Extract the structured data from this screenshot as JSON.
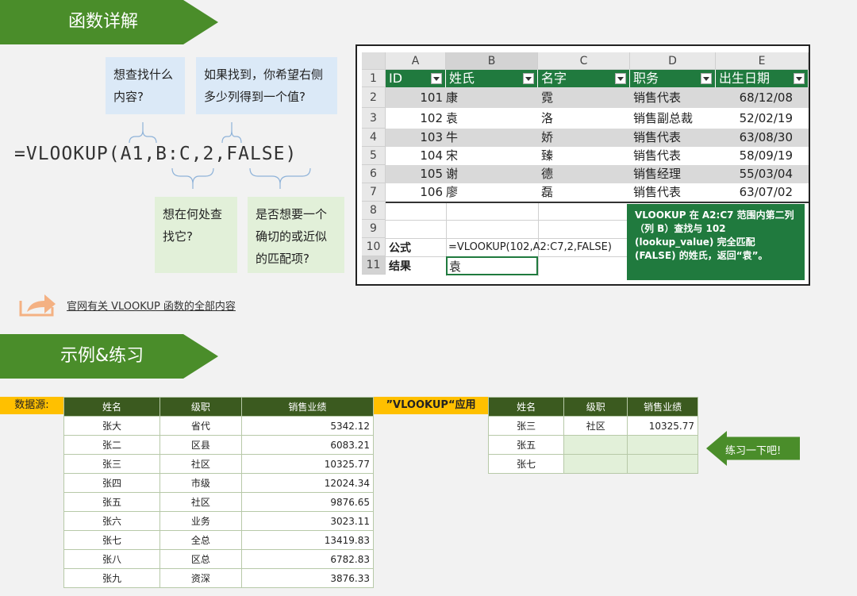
{
  "section1": {
    "title": "函数详解"
  },
  "section2": {
    "title": "示例&练习"
  },
  "callouts": {
    "what": "想查找什么内容?",
    "cols": "如果找到，你希望右侧多少列得到一个值?",
    "where": "想在何处查找它?",
    "exact": "是否想要一个确切的或近似的匹配项?"
  },
  "formula_display": "=VLOOKUP(A1,B:C,2,FALSE)",
  "link_text": "官网有关 VLOOKUP 函数的全部内容",
  "excel": {
    "col_headers": [
      "A",
      "B",
      "C",
      "D",
      "E"
    ],
    "row_headers": [
      "1",
      "2",
      "3",
      "4",
      "5",
      "6",
      "7",
      "8",
      "9",
      "10",
      "11"
    ],
    "table_headers": [
      "ID",
      "姓氏",
      "名字",
      "职务",
      "出生日期"
    ],
    "rows": [
      [
        "101",
        "康",
        "霓",
        "销售代表",
        "68/12/08"
      ],
      [
        "102",
        "袁",
        "洛",
        "销售副总裁",
        "52/02/19"
      ],
      [
        "103",
        "牛",
        "娇",
        "销售代表",
        "63/08/30"
      ],
      [
        "104",
        "宋",
        "臻",
        "销售代表",
        "58/09/19"
      ],
      [
        "105",
        "谢",
        "德",
        "销售经理",
        "55/03/04"
      ],
      [
        "106",
        "廖",
        "磊",
        "销售代表",
        "63/07/02"
      ]
    ],
    "formula_label": "公式",
    "formula": "=VLOOKUP(102,A2:C7,2,FALSE)",
    "result_label": "结果",
    "result": "袁",
    "tooltip": "VLOOKUP 在 A2:C7 范围内第二列（列 B）查找与 102 (lookup_value) 完全匹配 (FALSE) 的姓氏，返回“袁”。"
  },
  "source": {
    "label": "数据源:",
    "headers": [
      "姓名",
      "级职",
      "销售业绩"
    ],
    "rows": [
      [
        "张大",
        "省代",
        "5342.12"
      ],
      [
        "张二",
        "区县",
        "6083.21"
      ],
      [
        "张三",
        "社区",
        "10325.77"
      ],
      [
        "张四",
        "市级",
        "12024.34"
      ],
      [
        "张五",
        "社区",
        "9876.65"
      ],
      [
        "张六",
        "业务",
        "3023.11"
      ],
      [
        "张七",
        "全总",
        "13419.83"
      ],
      [
        "张八",
        "区总",
        "6782.83"
      ],
      [
        "张九",
        "资深",
        "3876.33"
      ]
    ]
  },
  "apply": {
    "label": "”VLOOKUP“应用",
    "headers": [
      "姓名",
      "级职",
      "销售业绩"
    ],
    "rows": [
      [
        "张三",
        "社区",
        "10325.77"
      ],
      [
        "张五",
        "",
        ""
      ],
      [
        "张七",
        "",
        ""
      ]
    ]
  },
  "practice": "练习一下吧!",
  "colors": {
    "banner": "#4a8d2a",
    "excel_header": "#207a3e",
    "table_header": "#3b5a1f",
    "label": "#ffc000"
  }
}
